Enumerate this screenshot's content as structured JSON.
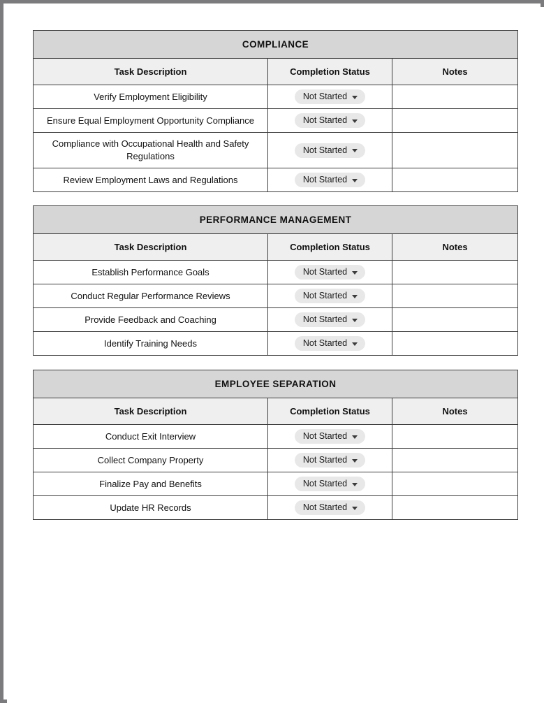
{
  "document": {
    "page_background": "#ffffff",
    "frame_color": "#7b7b7d",
    "columns": {
      "task": "Task Description",
      "status": "Completion Status",
      "notes": "Notes"
    },
    "status_default": "Not Started",
    "dropdown_icon": "chevron-down-icon"
  },
  "sections": [
    {
      "title": "COMPLIANCE",
      "headers": [
        "Task Description",
        "Completion Status",
        "Notes"
      ],
      "rows": [
        {
          "task": "Verify Employment Eligibility",
          "status": "Not Started",
          "notes": ""
        },
        {
          "task": "Ensure Equal Employment Opportunity Compliance",
          "status": "Not Started",
          "notes": ""
        },
        {
          "task": "Compliance with Occupational Health and Safety Regulations",
          "status": "Not Started",
          "notes": ""
        },
        {
          "task": "Review Employment Laws and Regulations",
          "status": "Not Started",
          "notes": ""
        }
      ]
    },
    {
      "title": "PERFORMANCE MANAGEMENT",
      "headers": [
        "Task Description",
        "Completion Status",
        "Notes"
      ],
      "rows": [
        {
          "task": "Establish Performance Goals",
          "status": "Not Started",
          "notes": ""
        },
        {
          "task": "Conduct Regular Performance Reviews",
          "status": "Not Started",
          "notes": ""
        },
        {
          "task": "Provide Feedback and Coaching",
          "status": "Not Started",
          "notes": ""
        },
        {
          "task": "Identify Training Needs",
          "status": "Not Started",
          "notes": ""
        }
      ]
    },
    {
      "title": "EMPLOYEE SEPARATION",
      "headers": [
        "Task Description",
        "Completion Status",
        "Notes"
      ],
      "rows": [
        {
          "task": "Conduct Exit Interview",
          "status": "Not Started",
          "notes": ""
        },
        {
          "task": "Collect Company Property",
          "status": "Not Started",
          "notes": ""
        },
        {
          "task": "Finalize Pay and Benefits",
          "status": "Not Started",
          "notes": ""
        },
        {
          "task": "Update HR Records",
          "status": "Not Started",
          "notes": ""
        }
      ]
    }
  ]
}
